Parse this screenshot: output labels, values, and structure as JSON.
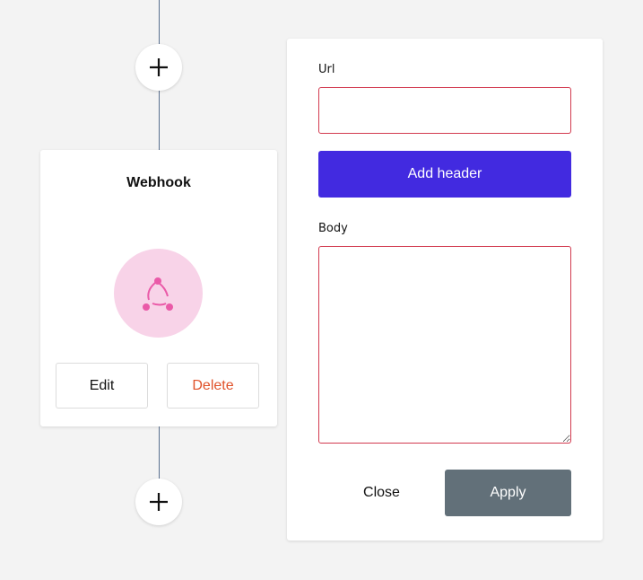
{
  "flow": {
    "add_step_top_label": "+",
    "add_step_bottom_label": "+"
  },
  "step_card": {
    "title": "Webhook",
    "icon": "webhook-icon",
    "icon_bg_color": "#f8d3e8",
    "icon_color": "#ea5aa8",
    "edit_label": "Edit",
    "delete_label": "Delete",
    "delete_color": "#e0522a"
  },
  "config_panel": {
    "url_label": "Url",
    "url_value": "",
    "add_header_label": "Add header",
    "body_label": "Body",
    "body_value": "",
    "close_label": "Close",
    "apply_label": "Apply",
    "primary_color": "#422ae0",
    "error_border_color": "#d23a4f"
  }
}
